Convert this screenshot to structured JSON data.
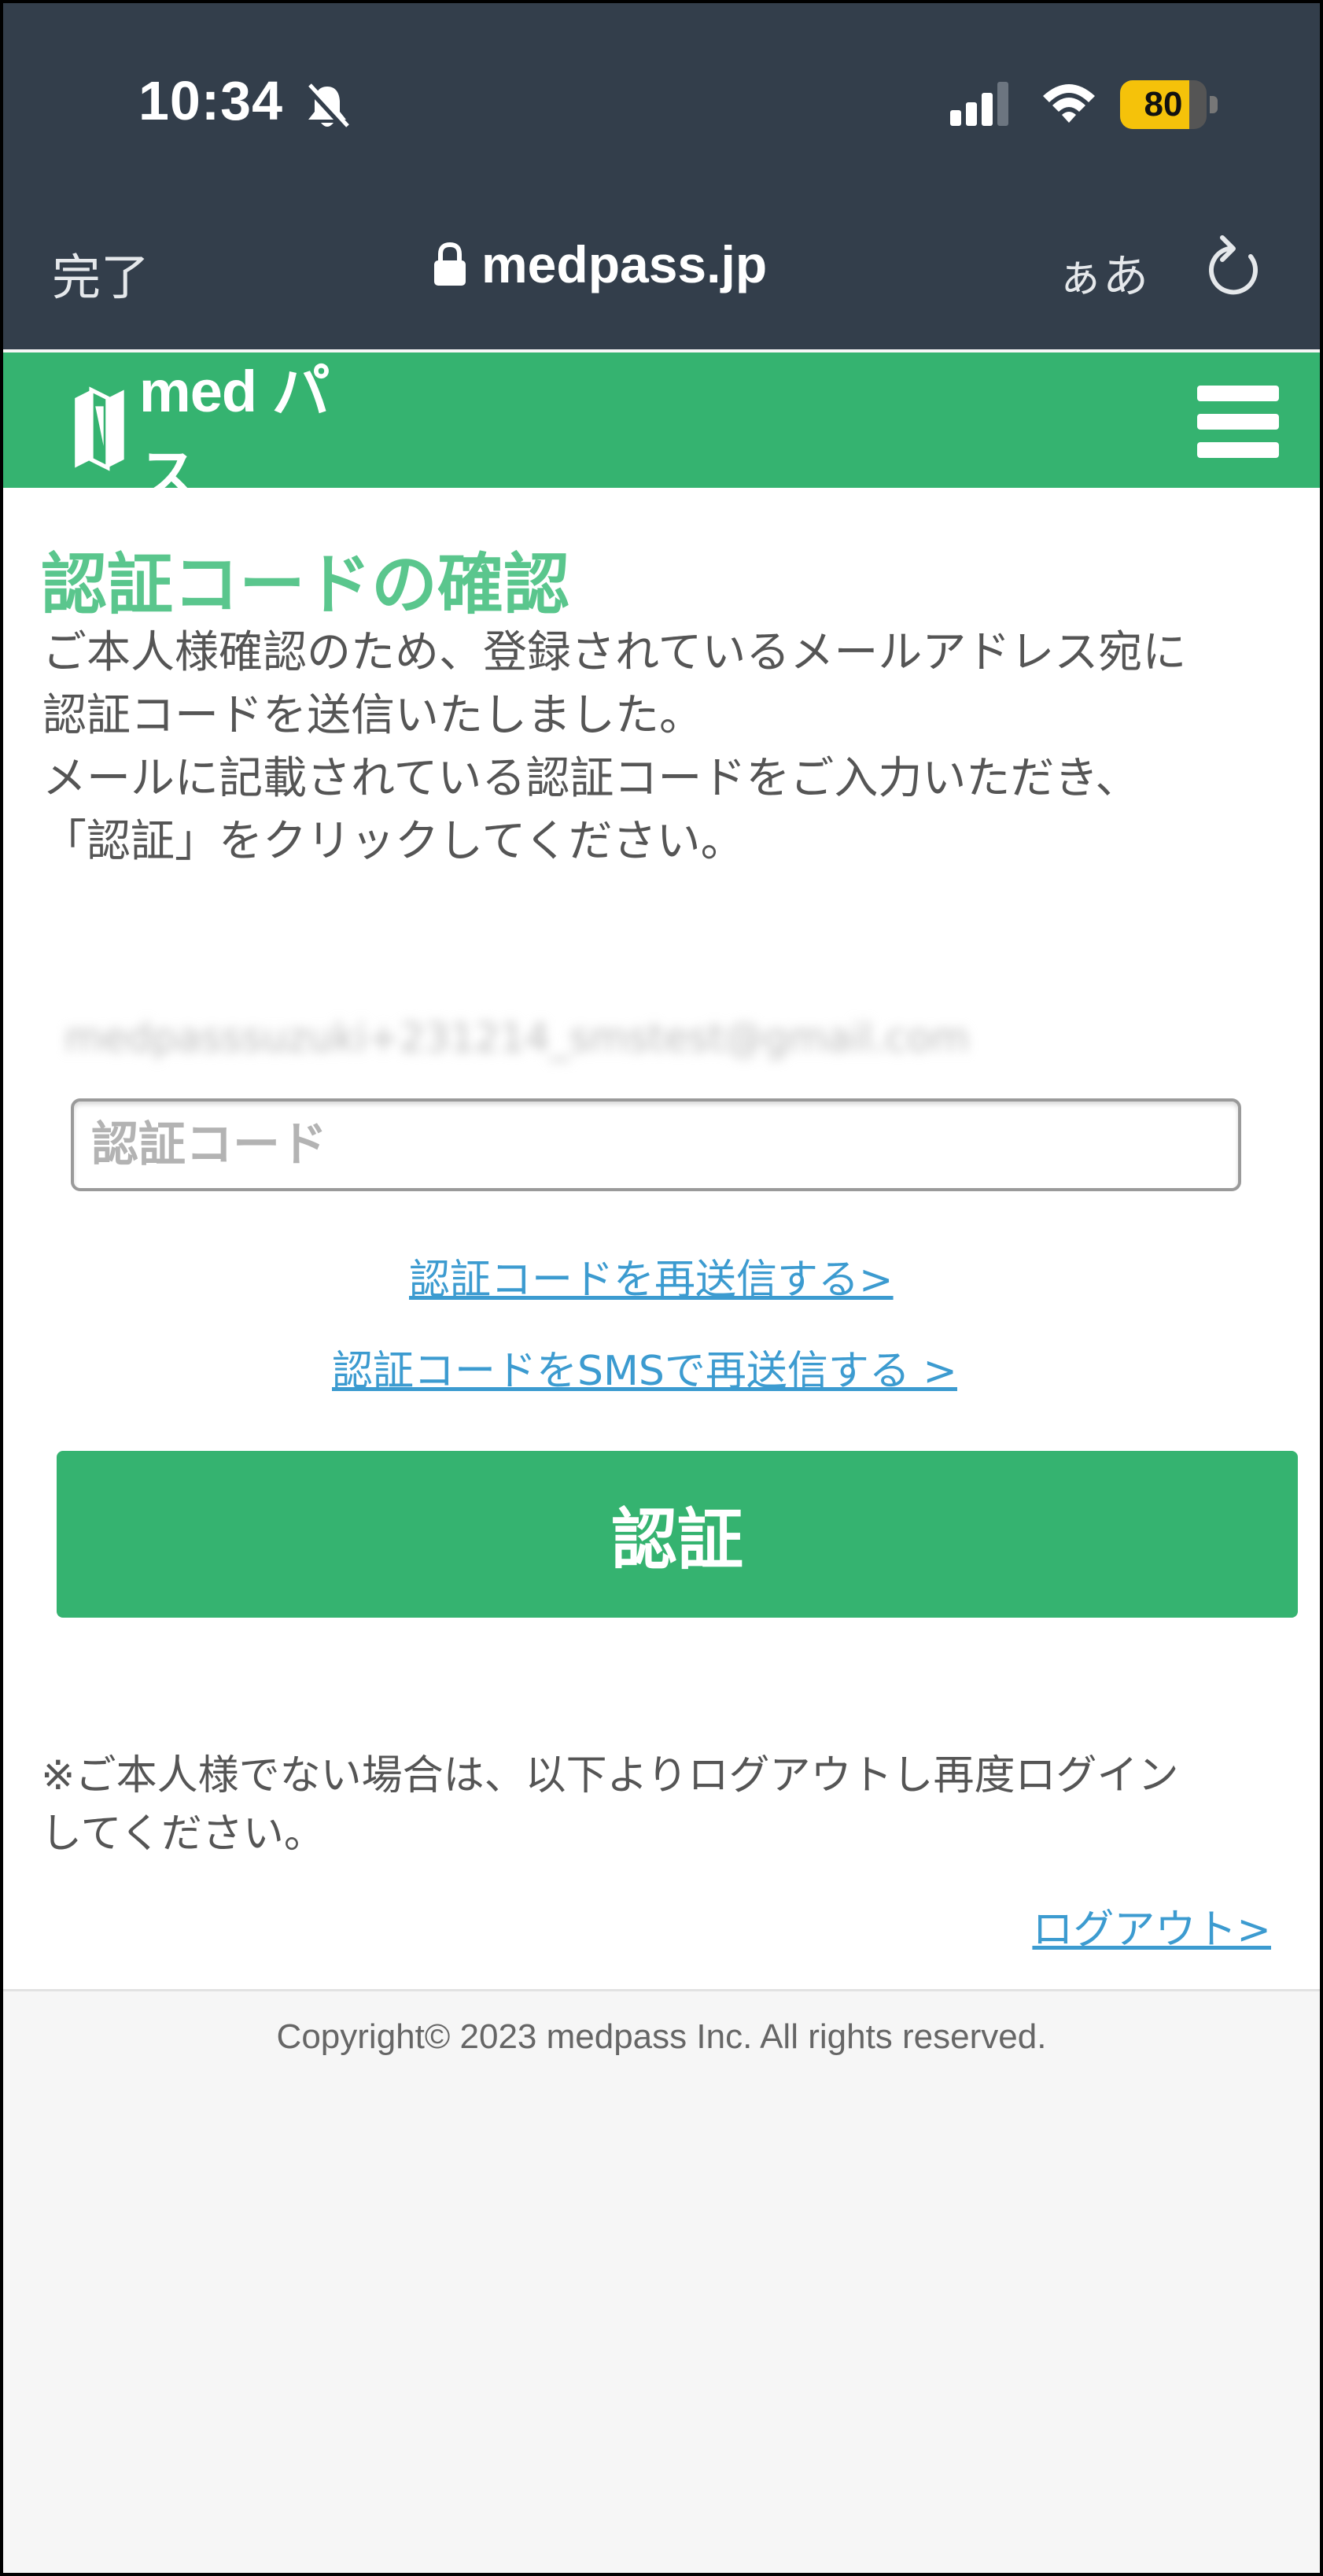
{
  "status_bar": {
    "time": "10:34",
    "battery_level": 80,
    "battery_label": "80",
    "battery_color": "#f5c20a"
  },
  "browser": {
    "done_label": "完了",
    "url": "medpass.jp",
    "text_size_label": "ぁあ",
    "lock_icon": "lock-icon",
    "reload_icon": "reload-icon"
  },
  "header": {
    "logo_text": "med パス",
    "menu_icon": "hamburger-menu-icon",
    "brand_color": "#35b370"
  },
  "main": {
    "title": "認証コードの確認",
    "description": [
      "ご本人様確認のため、登録されているメールアドレス宛に",
      "認証コードを送信いたしました。",
      "メールに記載されている認証コードをご入力いただき、",
      "「認証」をクリックしてください。"
    ],
    "email": "medpasssuzuki+231214_smstest@gmail.com",
    "code_placeholder": "認証コード",
    "resend_link": "認証コードを再送信する>",
    "resend_sms_link": "認証コードをSMSで再送信する >",
    "auth_button": "認証",
    "note": [
      "※ご本人様でない場合は、以下よりログアウトし再度ログイン",
      "してください。"
    ],
    "logout_link": "ログアウト>",
    "accent_color": "#5ac68d",
    "link_color": "#3c9bd0"
  },
  "footer": {
    "copyright": "Copyright© 2023 medpass Inc. All rights reserved."
  }
}
